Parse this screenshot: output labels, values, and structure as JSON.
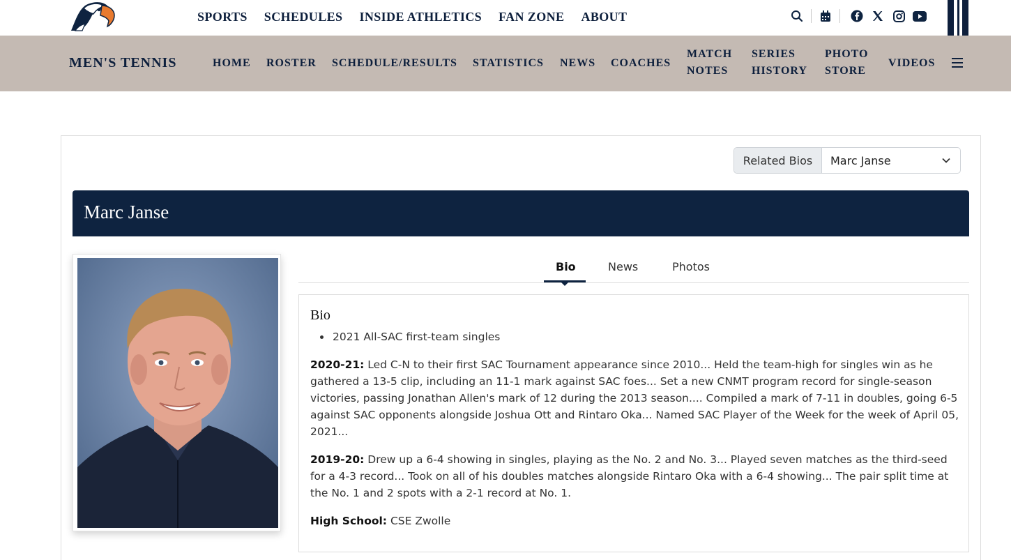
{
  "colors": {
    "navy": "#0e2340",
    "sport_bar": "#c4bab3",
    "accent_orange": "#e87a2f"
  },
  "main_nav": [
    "SPORTS",
    "SCHEDULES",
    "INSIDE ATHLETICS",
    "FAN ZONE",
    "ABOUT"
  ],
  "top_icons": [
    "search-icon",
    "calendar-icon",
    "facebook-icon",
    "x-icon",
    "instagram-icon",
    "youtube-icon"
  ],
  "sport": {
    "title": "MEN'S TENNIS",
    "nav": [
      "HOME",
      "ROSTER",
      "SCHEDULE/RESULTS",
      "STATISTICS",
      "NEWS",
      "COACHES",
      "MATCH\nNOTES",
      "SERIES\nHISTORY",
      "PHOTO\nSTORE",
      "VIDEOS"
    ],
    "menu_icon": "hamburger-icon"
  },
  "related_bios": {
    "label": "Related Bios",
    "selected": "Marc Janse"
  },
  "player": {
    "name": "Marc Janse"
  },
  "tabs": [
    {
      "label": "Bio",
      "active": true
    },
    {
      "label": "News",
      "active": false
    },
    {
      "label": "Photos",
      "active": false
    }
  ],
  "bio": {
    "heading": "Bio",
    "honors": [
      "2021 All-SAC first-team singles"
    ],
    "sections": [
      {
        "label": "2020-21:",
        "text": " Led C-N to their first SAC Tournament appearance since 2010... Held the team-high for singles win as he gathered a 13-5 clip, including an 11-1 mark against SAC foes... Set a new CNMT program record for single-season victories, passing Jonathan Allen's mark of 12 during the 2013 season.... Compiled a mark of 7-11 in doubles, going 6-5 against SAC opponents alongside Joshua Ott and Rintaro Oka... Named SAC Player of the Week for the week of April 05, 2021..."
      },
      {
        "label": "2019-20:",
        "text": " Drew up a 6-4 showing in singles, playing as the No. 2 and No. 3... Played seven matches as the third-seed for a 4-3 record... Took on all of his doubles matches alongside Rintaro Oka with a 6-4 showing... The pair split time at the No. 1 and 2 spots with a 2-1 record at No. 1."
      },
      {
        "label": "High School:",
        "text": " CSE Zwolle"
      }
    ]
  }
}
